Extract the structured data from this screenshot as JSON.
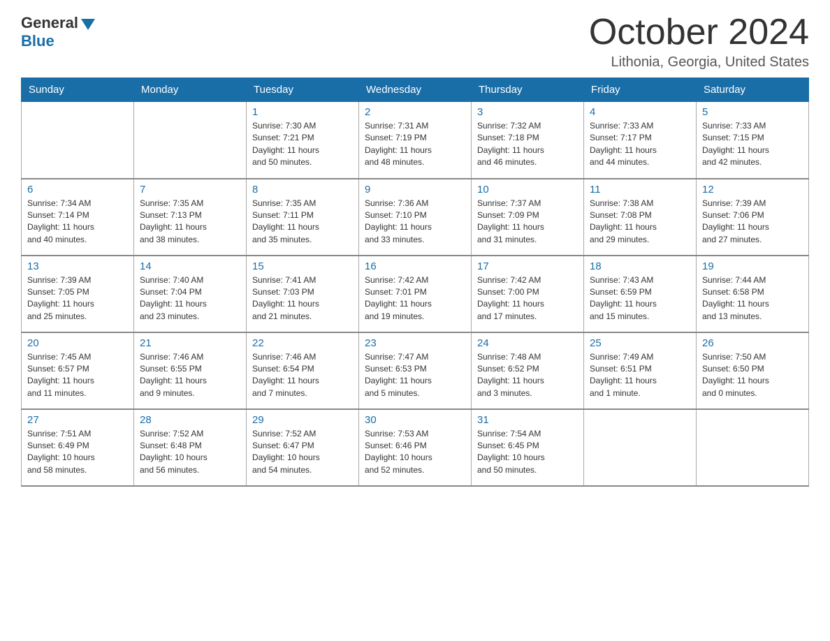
{
  "logo": {
    "general": "General",
    "blue": "Blue"
  },
  "title": "October 2024",
  "location": "Lithonia, Georgia, United States",
  "days_of_week": [
    "Sunday",
    "Monday",
    "Tuesday",
    "Wednesday",
    "Thursday",
    "Friday",
    "Saturday"
  ],
  "weeks": [
    [
      {
        "day": "",
        "info": ""
      },
      {
        "day": "",
        "info": ""
      },
      {
        "day": "1",
        "info": "Sunrise: 7:30 AM\nSunset: 7:21 PM\nDaylight: 11 hours\nand 50 minutes."
      },
      {
        "day": "2",
        "info": "Sunrise: 7:31 AM\nSunset: 7:19 PM\nDaylight: 11 hours\nand 48 minutes."
      },
      {
        "day": "3",
        "info": "Sunrise: 7:32 AM\nSunset: 7:18 PM\nDaylight: 11 hours\nand 46 minutes."
      },
      {
        "day": "4",
        "info": "Sunrise: 7:33 AM\nSunset: 7:17 PM\nDaylight: 11 hours\nand 44 minutes."
      },
      {
        "day": "5",
        "info": "Sunrise: 7:33 AM\nSunset: 7:15 PM\nDaylight: 11 hours\nand 42 minutes."
      }
    ],
    [
      {
        "day": "6",
        "info": "Sunrise: 7:34 AM\nSunset: 7:14 PM\nDaylight: 11 hours\nand 40 minutes."
      },
      {
        "day": "7",
        "info": "Sunrise: 7:35 AM\nSunset: 7:13 PM\nDaylight: 11 hours\nand 38 minutes."
      },
      {
        "day": "8",
        "info": "Sunrise: 7:35 AM\nSunset: 7:11 PM\nDaylight: 11 hours\nand 35 minutes."
      },
      {
        "day": "9",
        "info": "Sunrise: 7:36 AM\nSunset: 7:10 PM\nDaylight: 11 hours\nand 33 minutes."
      },
      {
        "day": "10",
        "info": "Sunrise: 7:37 AM\nSunset: 7:09 PM\nDaylight: 11 hours\nand 31 minutes."
      },
      {
        "day": "11",
        "info": "Sunrise: 7:38 AM\nSunset: 7:08 PM\nDaylight: 11 hours\nand 29 minutes."
      },
      {
        "day": "12",
        "info": "Sunrise: 7:39 AM\nSunset: 7:06 PM\nDaylight: 11 hours\nand 27 minutes."
      }
    ],
    [
      {
        "day": "13",
        "info": "Sunrise: 7:39 AM\nSunset: 7:05 PM\nDaylight: 11 hours\nand 25 minutes."
      },
      {
        "day": "14",
        "info": "Sunrise: 7:40 AM\nSunset: 7:04 PM\nDaylight: 11 hours\nand 23 minutes."
      },
      {
        "day": "15",
        "info": "Sunrise: 7:41 AM\nSunset: 7:03 PM\nDaylight: 11 hours\nand 21 minutes."
      },
      {
        "day": "16",
        "info": "Sunrise: 7:42 AM\nSunset: 7:01 PM\nDaylight: 11 hours\nand 19 minutes."
      },
      {
        "day": "17",
        "info": "Sunrise: 7:42 AM\nSunset: 7:00 PM\nDaylight: 11 hours\nand 17 minutes."
      },
      {
        "day": "18",
        "info": "Sunrise: 7:43 AM\nSunset: 6:59 PM\nDaylight: 11 hours\nand 15 minutes."
      },
      {
        "day": "19",
        "info": "Sunrise: 7:44 AM\nSunset: 6:58 PM\nDaylight: 11 hours\nand 13 minutes."
      }
    ],
    [
      {
        "day": "20",
        "info": "Sunrise: 7:45 AM\nSunset: 6:57 PM\nDaylight: 11 hours\nand 11 minutes."
      },
      {
        "day": "21",
        "info": "Sunrise: 7:46 AM\nSunset: 6:55 PM\nDaylight: 11 hours\nand 9 minutes."
      },
      {
        "day": "22",
        "info": "Sunrise: 7:46 AM\nSunset: 6:54 PM\nDaylight: 11 hours\nand 7 minutes."
      },
      {
        "day": "23",
        "info": "Sunrise: 7:47 AM\nSunset: 6:53 PM\nDaylight: 11 hours\nand 5 minutes."
      },
      {
        "day": "24",
        "info": "Sunrise: 7:48 AM\nSunset: 6:52 PM\nDaylight: 11 hours\nand 3 minutes."
      },
      {
        "day": "25",
        "info": "Sunrise: 7:49 AM\nSunset: 6:51 PM\nDaylight: 11 hours\nand 1 minute."
      },
      {
        "day": "26",
        "info": "Sunrise: 7:50 AM\nSunset: 6:50 PM\nDaylight: 11 hours\nand 0 minutes."
      }
    ],
    [
      {
        "day": "27",
        "info": "Sunrise: 7:51 AM\nSunset: 6:49 PM\nDaylight: 10 hours\nand 58 minutes."
      },
      {
        "day": "28",
        "info": "Sunrise: 7:52 AM\nSunset: 6:48 PM\nDaylight: 10 hours\nand 56 minutes."
      },
      {
        "day": "29",
        "info": "Sunrise: 7:52 AM\nSunset: 6:47 PM\nDaylight: 10 hours\nand 54 minutes."
      },
      {
        "day": "30",
        "info": "Sunrise: 7:53 AM\nSunset: 6:46 PM\nDaylight: 10 hours\nand 52 minutes."
      },
      {
        "day": "31",
        "info": "Sunrise: 7:54 AM\nSunset: 6:45 PM\nDaylight: 10 hours\nand 50 minutes."
      },
      {
        "day": "",
        "info": ""
      },
      {
        "day": "",
        "info": ""
      }
    ]
  ]
}
